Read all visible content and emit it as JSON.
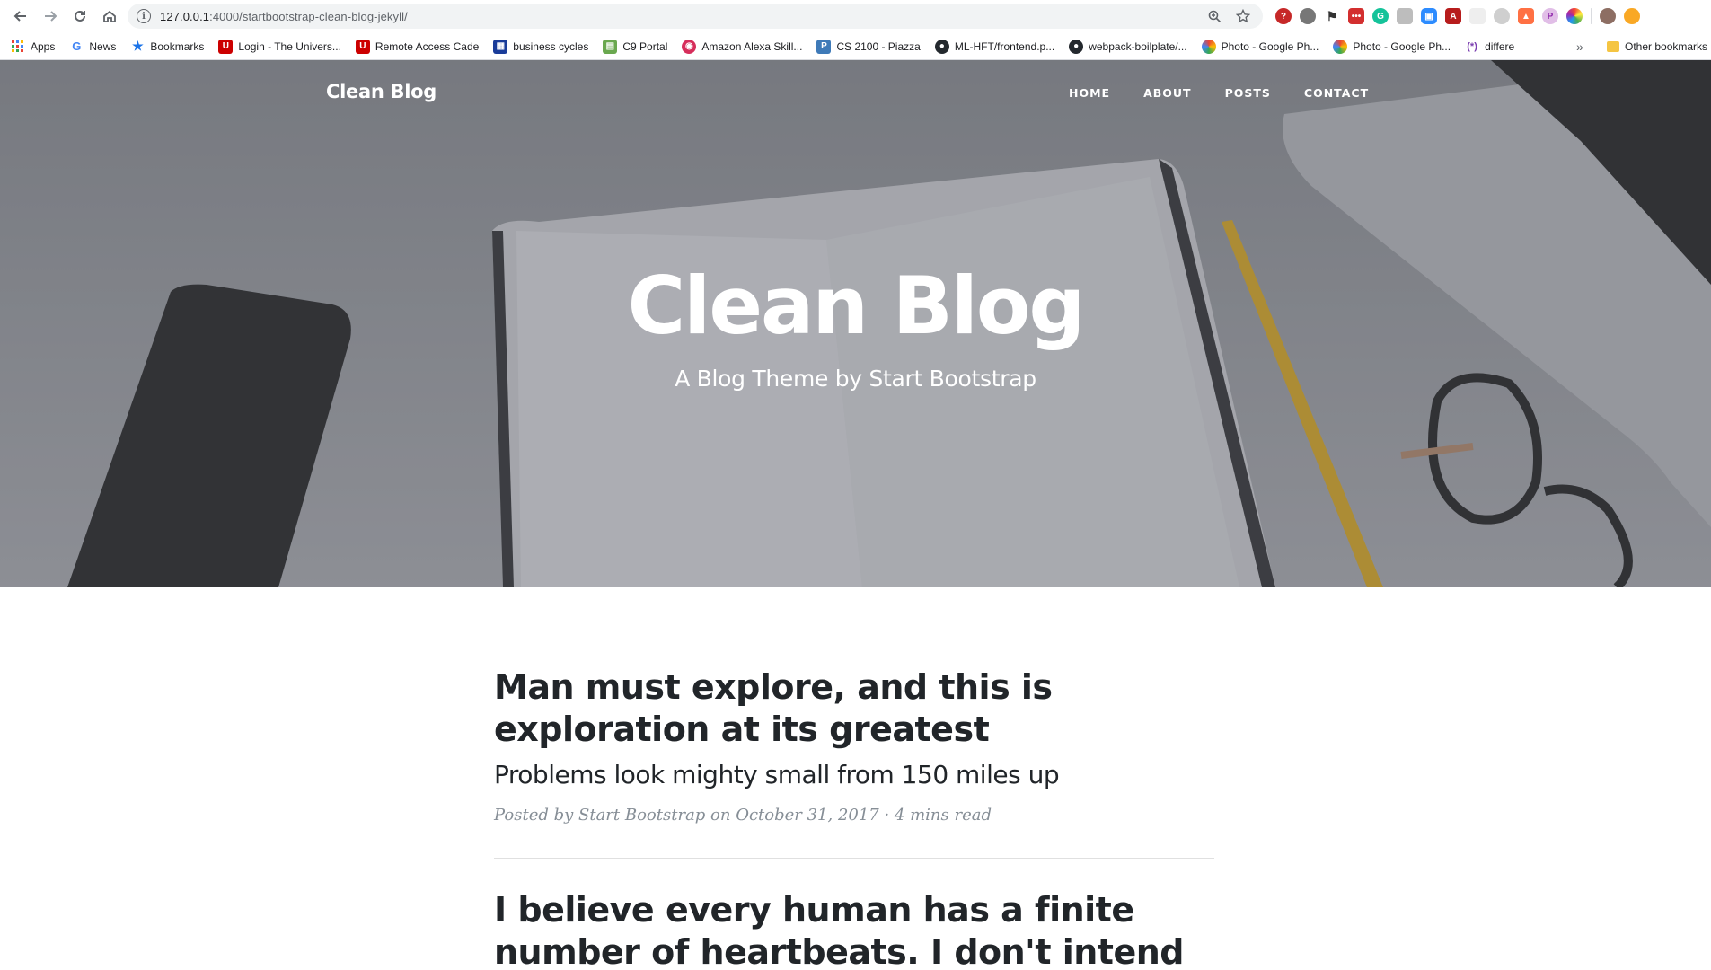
{
  "browser": {
    "url_host": "127.0.0.1",
    "url_path": ":4000/startbootstrap-clean-blog-jekyll/"
  },
  "bookmarks": [
    {
      "label": "Apps",
      "icon": "apps-grid-icon",
      "color": "#ea4335"
    },
    {
      "label": "News",
      "icon": "google-icon",
      "color": "#4285f4"
    },
    {
      "label": "Bookmarks",
      "icon": "star-icon",
      "color": "#1a73e8"
    },
    {
      "label": "Login - The Univers...",
      "icon": "u-logo-icon",
      "color": "#cc0000"
    },
    {
      "label": "Remote Access Cade",
      "icon": "u-logo-icon",
      "color": "#cc0000"
    },
    {
      "label": "business cycles",
      "icon": "grid-doc-icon",
      "color": "#1a3c99"
    },
    {
      "label": "C9 Portal",
      "icon": "c9-icon",
      "color": "#6aa84f"
    },
    {
      "label": "Amazon Alexa Skill...",
      "icon": "alexa-icon",
      "color": "#d62e5b"
    },
    {
      "label": "CS 2100 - Piazza",
      "icon": "piazza-icon",
      "color": "#3e7ab8"
    },
    {
      "label": "ML-HFT/frontend.p...",
      "icon": "github-icon",
      "color": "#24292e"
    },
    {
      "label": "webpack-boilplate/...",
      "icon": "github-icon",
      "color": "#24292e"
    },
    {
      "label": "Photo - Google Ph...",
      "icon": "google-photos-icon",
      "color": "#fbbc04"
    },
    {
      "label": "Photo - Google Ph...",
      "icon": "google-photos-icon",
      "color": "#fbbc04"
    },
    {
      "label": "differe",
      "icon": "regex-icon",
      "color": "#7b3fb0"
    }
  ],
  "bookmarks_overflow": "»",
  "other_bookmarks": "Other bookmarks",
  "site": {
    "brand": "Clean Blog",
    "nav": [
      "HOME",
      "ABOUT",
      "POSTS",
      "CONTACT"
    ],
    "hero_title": "Clean Blog",
    "hero_subtitle": "A Blog Theme by Start Bootstrap"
  },
  "posts": [
    {
      "title": "Man must explore, and this is exploration at its greatest",
      "subtitle": "Problems look mighty small from 150 miles up",
      "meta": "Posted by Start Bootstrap on October 31, 2017 · 4 mins read"
    },
    {
      "title": "I believe every human has a finite number of heartbeats. I don't intend to",
      "subtitle": "",
      "meta": ""
    }
  ]
}
